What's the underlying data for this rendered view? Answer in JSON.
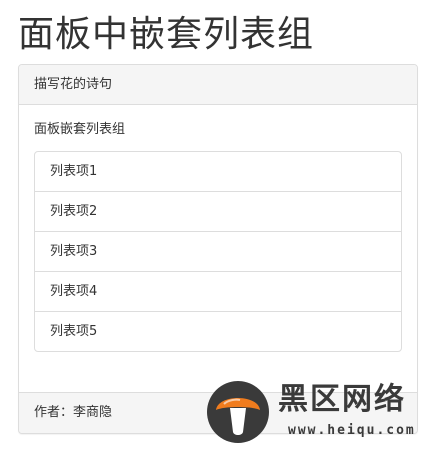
{
  "page": {
    "title": "面板中嵌套列表组"
  },
  "panel": {
    "heading": "描写花的诗句",
    "body_text": "面板嵌套列表组",
    "items": [
      {
        "label": "列表项1"
      },
      {
        "label": "列表项2"
      },
      {
        "label": "列表项3"
      },
      {
        "label": "列表项4"
      },
      {
        "label": "列表项5"
      }
    ],
    "footer": "作者：李商隐"
  },
  "watermark": {
    "title": "黑区网络",
    "url": "www.heiqu.com"
  },
  "colors": {
    "panel_border": "#dddddd",
    "panel_heading_bg": "#f5f5f5",
    "text": "#333333",
    "logo_orange": "#f07c1e",
    "logo_dark": "#3a3a3a"
  }
}
